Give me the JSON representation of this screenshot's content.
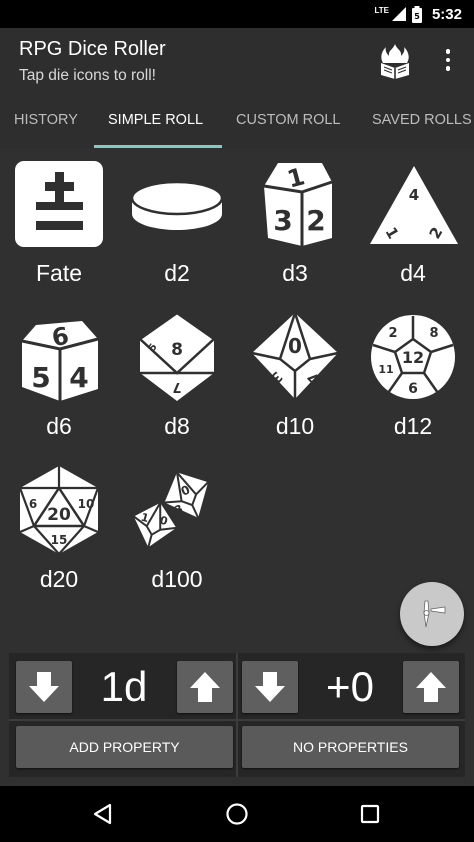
{
  "status_bar": {
    "network": "LTE",
    "time": "5:32",
    "battery_level": "5"
  },
  "app_bar": {
    "title": "RPG Dice Roller",
    "subtitle": "Tap die icons to roll!",
    "logo_icon": "fire-book-icon",
    "menu_icon": "overflow-menu-icon"
  },
  "tabs": [
    {
      "label": "HISTORY",
      "active": false
    },
    {
      "label": "SIMPLE ROLL",
      "active": true
    },
    {
      "label": "CUSTOM ROLL",
      "active": false
    },
    {
      "label": "SAVED ROLLS",
      "active": false
    }
  ],
  "dice": [
    {
      "label": "Fate",
      "icon": "fate-die-icon"
    },
    {
      "label": "d2",
      "icon": "d2-coin-icon"
    },
    {
      "label": "d3",
      "icon": "d3-die-icon"
    },
    {
      "label": "d4",
      "icon": "d4-die-icon"
    },
    {
      "label": "d6",
      "icon": "d6-die-icon"
    },
    {
      "label": "d8",
      "icon": "d8-die-icon"
    },
    {
      "label": "d10",
      "icon": "d10-die-icon"
    },
    {
      "label": "d12",
      "icon": "d12-die-icon"
    },
    {
      "label": "d20",
      "icon": "d20-die-icon"
    },
    {
      "label": "d100",
      "icon": "d100-dice-icon"
    }
  ],
  "die_faces": {
    "d3": [
      "1",
      "3",
      "2"
    ],
    "d4": [
      "4",
      "1",
      "2"
    ],
    "d6": [
      "6",
      "5",
      "4"
    ],
    "d8": [
      "8",
      "5",
      "7"
    ],
    "d10": [
      "0",
      "3",
      "7"
    ],
    "d12": [
      "12",
      "2",
      "8",
      "11",
      "6"
    ],
    "d20": [
      "20",
      "6",
      "10",
      "15"
    ],
    "d100": [
      "0",
      "3",
      "1",
      "0"
    ]
  },
  "fab": {
    "icon": "paintbrush-icon"
  },
  "controls": {
    "dice_count": "1d",
    "modifier": "+0",
    "add_property_label": "ADD PROPERTY",
    "no_properties_label": "NO PROPERTIES"
  },
  "colors": {
    "app_bar": "#2e2e2e",
    "background": "#303030",
    "tab_indicator": "#80cbc4",
    "button": "#5f5f5f",
    "fab": "#c9c9c9"
  },
  "nav_bar": {
    "back_icon": "back-icon",
    "home_icon": "home-icon",
    "recents_icon": "recents-icon"
  }
}
